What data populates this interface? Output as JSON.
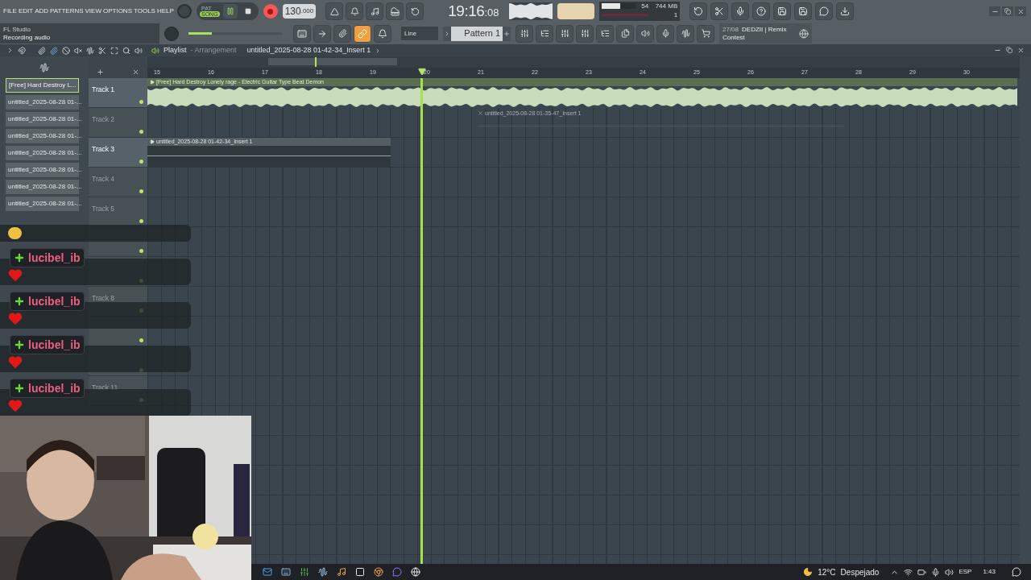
{
  "menu": [
    "FILE",
    "EDIT",
    "ADD",
    "PATTERNS",
    "VIEW",
    "OPTIONS",
    "TOOLS",
    "HELP"
  ],
  "hint": {
    "title": "FL Studio",
    "text": "Recording audio"
  },
  "transport": {
    "modes": [
      {
        "label": "PAT",
        "selected": false
      },
      {
        "label": "SONG",
        "selected": true
      }
    ],
    "recording": true,
    "tempo": "130",
    "tempo_fraction": ".000",
    "time": "19:16",
    "time_seconds": ":08",
    "master_volume": {
      "level": 0.25
    }
  },
  "cpu": {
    "polyphony": "54",
    "memory": "744 MB",
    "count": "1",
    "level": 0.55
  },
  "snap": {
    "value": "Line"
  },
  "pattern": {
    "name": "Pattern 1"
  },
  "news": {
    "date": "27/08",
    "title": "DEDZII | Remix",
    "subtitle": "Contest"
  },
  "playlist": {
    "title": "Playlist",
    "view": "- Arrangement",
    "clip_path": "untitled_2025-08-28 01-42-34_Insert 1"
  },
  "browser": [
    {
      "label": "[Free] Hard Destroy L...",
      "selected": true
    },
    {
      "label": "untitled_2025-08-28 01-...",
      "selected": false
    },
    {
      "label": "untitled_2025-08-28 01-...",
      "selected": false
    },
    {
      "label": "untitled_2025-08-28 01-...",
      "selected": false
    },
    {
      "label": "untitled_2025-08-28 01-...",
      "selected": false
    },
    {
      "label": "untitled_2025-08-28 01-...",
      "selected": false
    },
    {
      "label": "untitled_2025-08-28 01-...",
      "selected": false
    },
    {
      "label": "untitled_2025-08-28 01-...",
      "selected": false
    }
  ],
  "ruler": [
    "15",
    "16",
    "17",
    "18",
    "19",
    "20",
    "21",
    "22",
    "23",
    "24",
    "25",
    "26",
    "27",
    "28",
    "29",
    "30"
  ],
  "tracks": [
    {
      "label": "Track 1",
      "empty": false,
      "clip": {
        "kind": "audio",
        "name": "[Free] Hard Destroy Lonely rage - Electric Guitar Type Beat Demon"
      }
    },
    {
      "label": "Track 2",
      "empty": true,
      "clip": {
        "kind": "ghost",
        "name": "untitled_2025-08-28 01-35-47_Insert 1"
      }
    },
    {
      "label": "Track 3",
      "empty": false,
      "clip": {
        "kind": "recording",
        "name": "untitled_2025-08-28 01-42-34_Insert 1"
      }
    },
    {
      "label": "Track 4",
      "empty": true
    },
    {
      "label": "Track 5",
      "empty": true
    },
    {
      "empty": true
    },
    {
      "empty": true
    },
    {
      "label": "Track 8",
      "empty": true
    },
    {
      "empty": true
    },
    {
      "empty": true
    },
    {
      "label": "Track 11",
      "empty": true
    }
  ],
  "chat": [
    {
      "kind": "emote"
    },
    {
      "kind": "message",
      "user": "lucibel_ib"
    },
    {
      "kind": "message",
      "user": "lucibel_ib"
    },
    {
      "kind": "message",
      "user": "lucibel_ib"
    },
    {
      "kind": "message",
      "user": "lucibel_ib"
    }
  ],
  "taskbar": {
    "weather": "12°C",
    "condition": "Despejado",
    "language": "ESP",
    "clock": "1:43"
  }
}
